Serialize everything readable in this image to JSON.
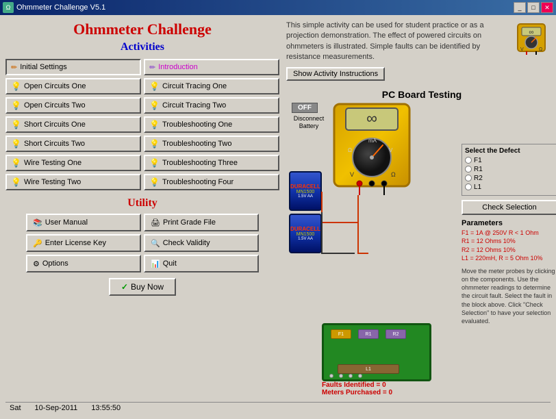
{
  "window": {
    "title": "Ohmmeter Challenge V5.1",
    "icon": "Ω"
  },
  "app": {
    "title": "Ohmmeter Challenge",
    "activities_label": "Activities",
    "utility_label": "Utility",
    "description": "This simple activity can be used for student practice or as a projection demonstration. The effect of powered circuits on ohmmeters is illustrated. Simple faults can be identified by resistance measurements.",
    "show_instructions": "Show Activity Instructions",
    "pc_board_title": "PC Board Testing"
  },
  "activities": {
    "col1": [
      {
        "id": "initial-settings",
        "label": "Initial Settings",
        "icon": "pencil",
        "special": true
      },
      {
        "id": "open-circuits-one",
        "label": "Open Circuits One",
        "icon": "bulb"
      },
      {
        "id": "open-circuits-two",
        "label": "Open Circuits Two",
        "icon": "bulb"
      },
      {
        "id": "short-circuits-one",
        "label": "Short Circuits One",
        "icon": "bulb"
      },
      {
        "id": "short-circuits-two",
        "label": "Short Circuits Two",
        "icon": "bulb"
      },
      {
        "id": "wire-testing-one",
        "label": "Wire Testing One",
        "icon": "bulb"
      },
      {
        "id": "wire-testing-two",
        "label": "Wire Testing Two",
        "icon": "bulb"
      }
    ],
    "col2": [
      {
        "id": "introduction",
        "label": "Introduction",
        "icon": "pencil",
        "special": true
      },
      {
        "id": "circuit-tracing-one",
        "label": "Circuit Tracing One",
        "icon": "bulb"
      },
      {
        "id": "circuit-tracing-two",
        "label": "Circuit Tracing Two",
        "icon": "bulb"
      },
      {
        "id": "troubleshooting-one",
        "label": "Troubleshooting One",
        "icon": "bulb"
      },
      {
        "id": "troubleshooting-two",
        "label": "Troubleshooting Two",
        "icon": "bulb"
      },
      {
        "id": "troubleshooting-three",
        "label": "Troubleshooting Three",
        "icon": "bulb"
      },
      {
        "id": "troubleshooting-four",
        "label": "Troubleshooting Four",
        "icon": "bulb"
      }
    ]
  },
  "utility": {
    "buttons": [
      {
        "id": "user-manual",
        "label": "User Manual",
        "icon": "book"
      },
      {
        "id": "print-grade-file",
        "label": "Print Grade File",
        "icon": "printer"
      },
      {
        "id": "enter-license-key",
        "label": "Enter License Key",
        "icon": "key"
      },
      {
        "id": "check-validity",
        "label": "Check Validity",
        "icon": "magnifier"
      },
      {
        "id": "options",
        "label": "Options",
        "icon": "gear"
      },
      {
        "id": "quit",
        "label": "Quit",
        "icon": "bar-chart"
      }
    ],
    "buy_now": "Buy Now"
  },
  "circuit": {
    "off_button": "OFF",
    "disconnect_label": "Disconnect\nBattery",
    "faults_identified": "Faults Identified = 0",
    "meters_purchased": "Meters Purchased = 0",
    "select_defect_title": "Select the Defect",
    "defects": [
      "F1",
      "R1",
      "R2",
      "L1"
    ],
    "check_selection": "Check Selection",
    "parameters_title": "Parameters",
    "parameters": [
      "F1 = 1A @ 250V  R < 1 Ohm",
      "R1 = 12 Ohms  10%",
      "R2 = 12 Ohms  10%",
      "L1 = 220mH,  R = 5 Ohm  10%"
    ],
    "instructions": "Move the meter probes by clicking on the components. Use the ohmmeter readings to determine the circuit fault. Select the fault in the block above. Click \"Check Selection\" to have your selection evaluated."
  },
  "status_bar": {
    "day": "Sat",
    "date": "10-Sep-2011",
    "time": "13:55:50"
  }
}
